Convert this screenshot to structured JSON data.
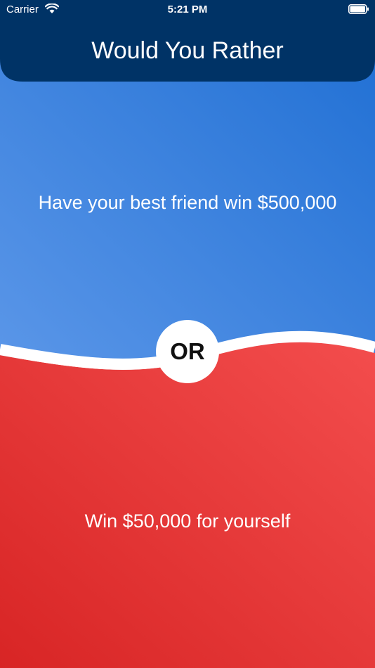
{
  "status_bar": {
    "carrier": "Carrier",
    "time": "5:21 PM",
    "wifi_icon": "wifi-icon",
    "battery_icon": "battery-icon"
  },
  "header": {
    "title": "Would You Rather"
  },
  "options": {
    "first": "Have your best friend win $500,000",
    "divider_label": "OR",
    "second": "Win $50,000 for yourself"
  },
  "colors": {
    "header": "#003366",
    "top_gradient": [
      "#1f6fd4",
      "#5593e6"
    ],
    "bottom_gradient": [
      "#f04c4c",
      "#d92626"
    ],
    "divider": "#ffffff"
  }
}
